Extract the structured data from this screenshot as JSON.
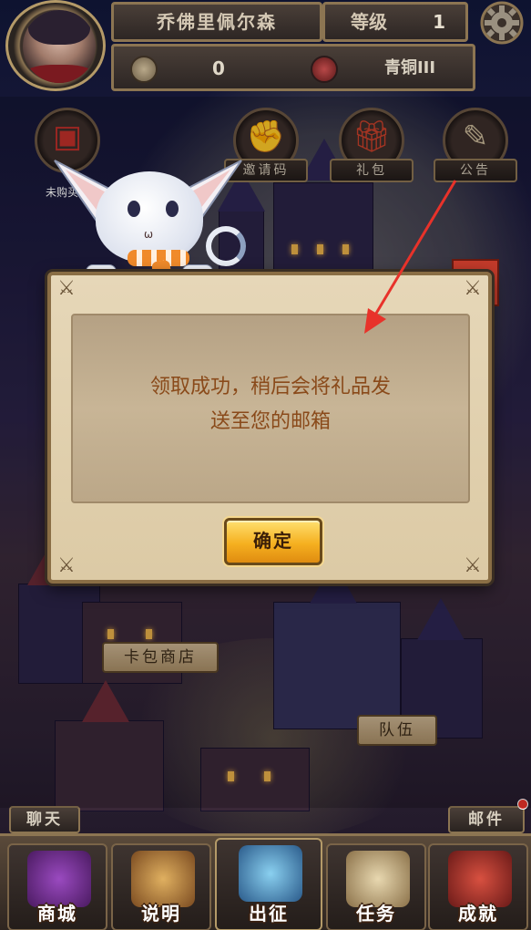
{
  "player": {
    "name": "乔佛里佩尔森",
    "level_label": "等级",
    "level_value": "1",
    "coins": "0",
    "rank": "青铜III"
  },
  "top_icons": [
    {
      "id": "unknown",
      "label": "",
      "sub_label": "未购买"
    },
    {
      "id": "invite",
      "label": "邀请码"
    },
    {
      "id": "gift",
      "label": "礼包"
    },
    {
      "id": "notice",
      "label": "公告"
    }
  ],
  "dialog": {
    "message_line1": "领取成功，稍后会将礼品发",
    "message_line2": "送至您的邮箱",
    "confirm_label": "确定"
  },
  "map_labels": {
    "card_shop": "卡包商店",
    "team": "队伍"
  },
  "side": {
    "chat": "聊天",
    "mail": "邮件"
  },
  "bottom_nav": [
    {
      "id": "shop",
      "label": "商城"
    },
    {
      "id": "help",
      "label": "说明"
    },
    {
      "id": "battle",
      "label": "出征"
    },
    {
      "id": "tasks",
      "label": "任务"
    },
    {
      "id": "achievements",
      "label": "成就"
    }
  ],
  "colors": {
    "dialog_text": "#8a4a1a",
    "confirm_button": "#f5b020",
    "arrow": "#e8322a"
  }
}
